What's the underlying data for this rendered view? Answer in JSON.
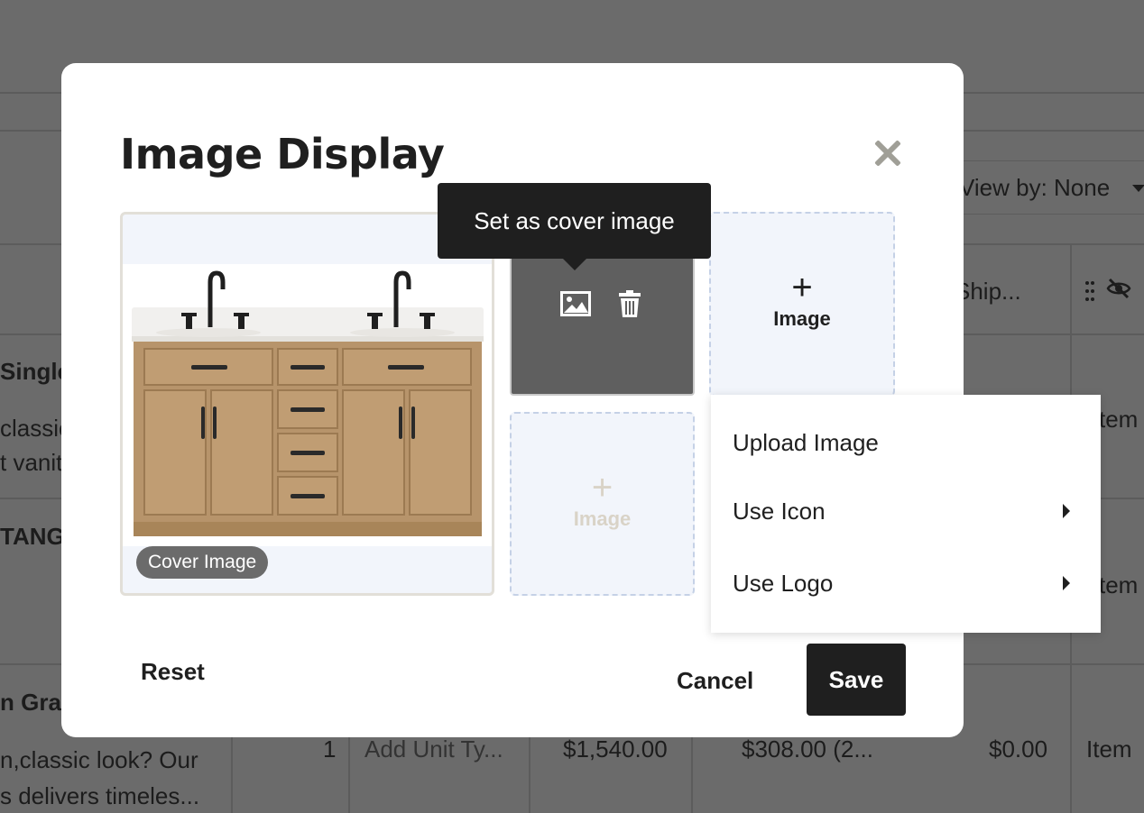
{
  "background": {
    "view_by": "View by: None",
    "column_ship": "Ship...",
    "row1_title": "Single",
    "row1_desc1": "classic",
    "row1_desc2": "t vanity",
    "row2_title": "TANGO",
    "row2_item": "tem",
    "row1_item": "tem",
    "row3_title": "n Grai...",
    "row3_desc1": "n,classic look? Our",
    "row3_desc2": "s delivers timeles...",
    "row3_qty": "1",
    "row3_unit": "Add Unit Ty...",
    "row3_price": "$1,540.00",
    "row3_discount": "$308.00 (2...",
    "row3_shipping": "$0.00",
    "row3_type": "Item"
  },
  "modal": {
    "title": "Image Display",
    "cover_badge": "Cover Image",
    "tooltip": "Set as cover image",
    "add_image_label": "Image",
    "add_image_plus": "+",
    "reset_label": "Reset",
    "cancel_label": "Cancel",
    "save_label": "Save"
  },
  "menu": {
    "items": [
      {
        "label": "Upload Image",
        "has_submenu": false
      },
      {
        "label": "Use Icon",
        "has_submenu": true
      },
      {
        "label": "Use Logo",
        "has_submenu": true
      }
    ]
  },
  "icons": {
    "close": "close-icon",
    "set_cover": "image-icon",
    "delete": "trash-icon",
    "column_drag": "drag-handle-icon",
    "column_visibility": "eye-off-icon"
  },
  "colors": {
    "overlay": "#6b6b6b",
    "primary_button": "#1f1f1f",
    "slot_background": "#f2f5fb",
    "slot_border": "#c5d1e6",
    "close_icon": "#a09f97"
  }
}
